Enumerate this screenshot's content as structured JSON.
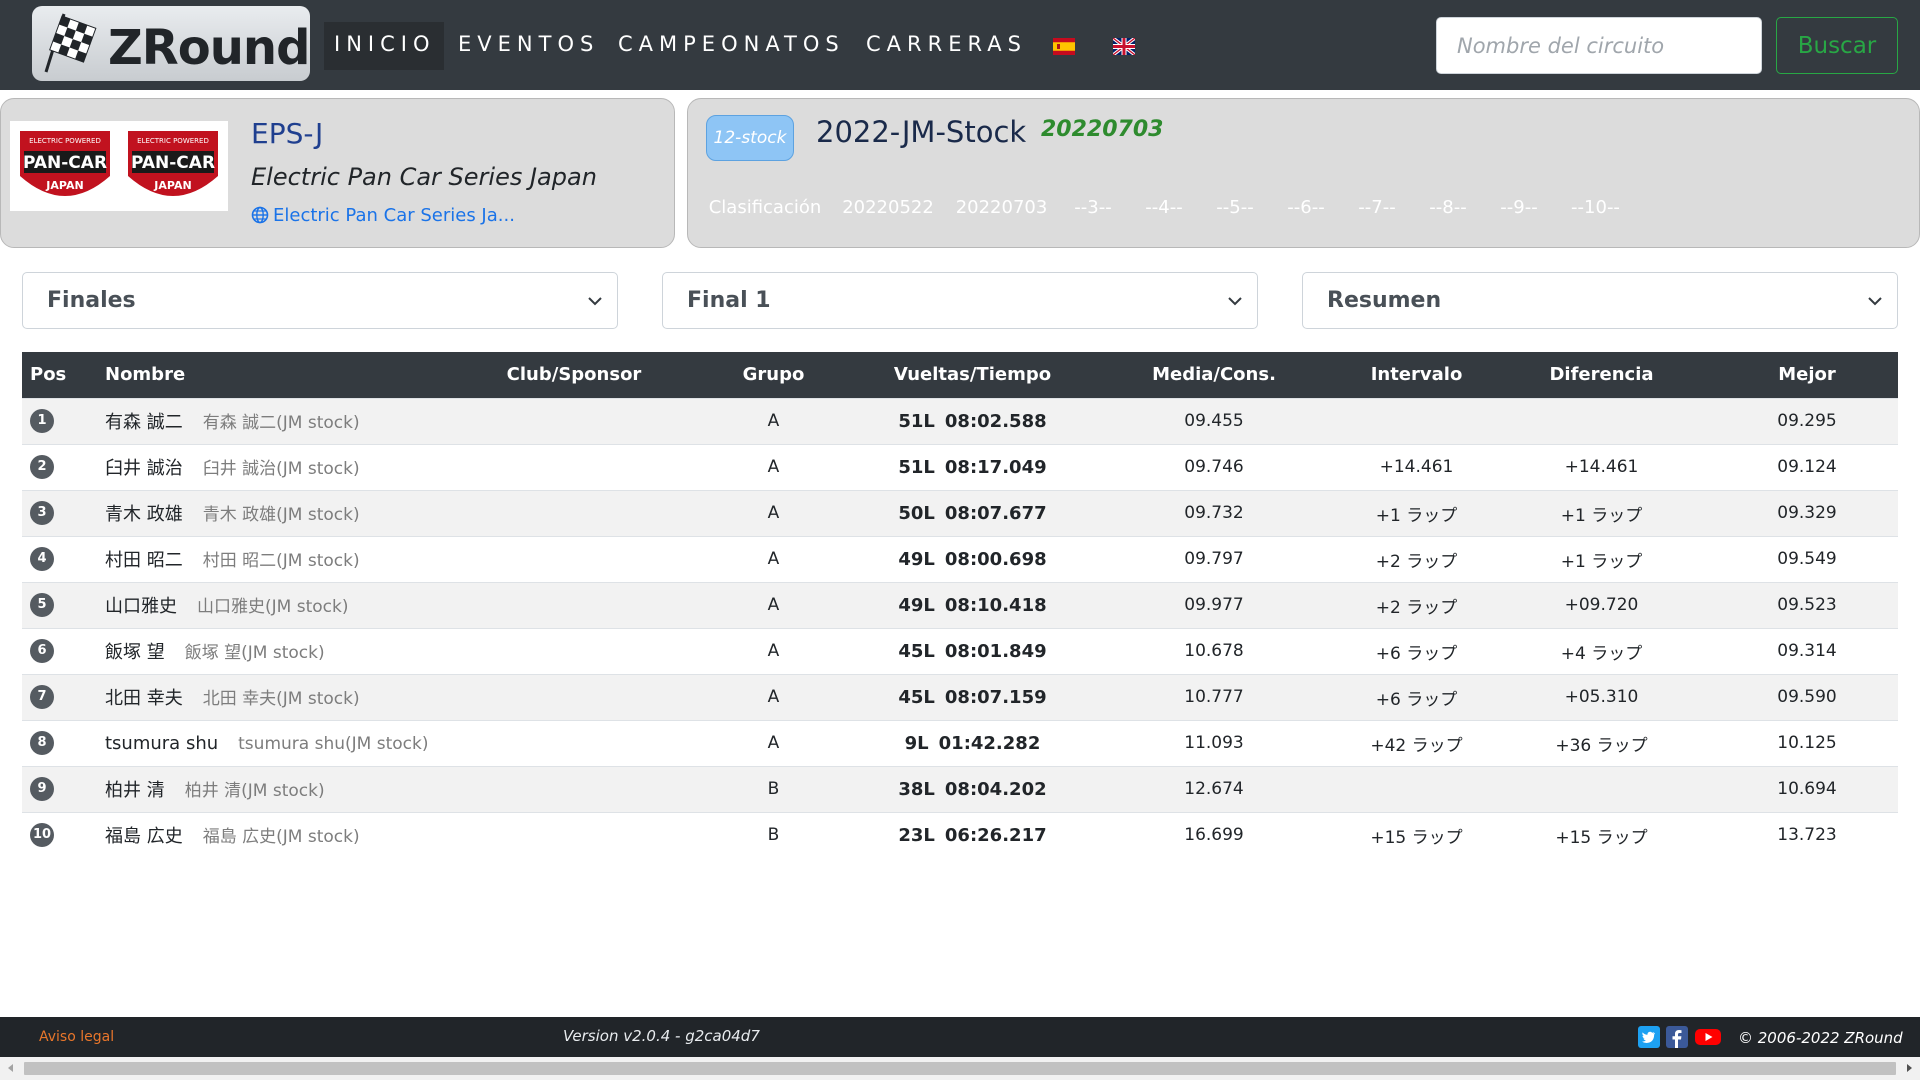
{
  "brand": {
    "name": "ZRound"
  },
  "nav": {
    "items": [
      {
        "label": "INICIO"
      },
      {
        "label": "EVENTOS"
      },
      {
        "label": "CAMPEONATOS"
      },
      {
        "label": "CARRERAS"
      }
    ],
    "flags": [
      "flag-es-icon",
      "flag-gb-icon"
    ]
  },
  "search": {
    "placeholder": "Nombre del circuito",
    "value": "",
    "button": "Buscar"
  },
  "club": {
    "short": "EPS-J",
    "full": "Electric Pan Car Series Japan",
    "link": "Electric Pan Car Series Ja..."
  },
  "championship": {
    "class": "12-stock",
    "title": "2022-JM-Stock",
    "date": "20220703",
    "rounds": [
      {
        "label": "Clasificación",
        "state": "classif"
      },
      {
        "label": "20220522",
        "state": "done"
      },
      {
        "label": "20220703",
        "state": "done"
      },
      {
        "label": "--3--",
        "state": "pending"
      },
      {
        "label": "--4--",
        "state": "pending"
      },
      {
        "label": "--5--",
        "state": "pending"
      },
      {
        "label": "--6--",
        "state": "pending"
      },
      {
        "label": "--7--",
        "state": "pending"
      },
      {
        "label": "--8--",
        "state": "pending"
      },
      {
        "label": "--9--",
        "state": "pending"
      },
      {
        "label": "--10--",
        "state": "pending"
      }
    ]
  },
  "selects": {
    "session_type": "Finales",
    "session": "Final 1",
    "view": "Resumen"
  },
  "table": {
    "headers": [
      "Pos",
      "Nombre",
      "Club/Sponsor",
      "Grupo",
      "Vueltas/Tiempo",
      "Media/Cons.",
      "Intervalo",
      "Diferencia",
      "Mejor"
    ],
    "rows": [
      {
        "pos": "1",
        "name": "有森 誠二",
        "sub": "有森 誠二(JM stock)",
        "club": "",
        "group": "A",
        "laps": "51L",
        "time": "08:02.588",
        "avg": "09.455",
        "interval": "",
        "diff": "",
        "best": "09.295"
      },
      {
        "pos": "2",
        "name": "臼井 誠治",
        "sub": "臼井 誠治(JM stock)",
        "club": "",
        "group": "A",
        "laps": "51L",
        "time": "08:17.049",
        "avg": "09.746",
        "interval": "+14.461",
        "diff": "+14.461",
        "best": "09.124"
      },
      {
        "pos": "3",
        "name": "青木 政雄",
        "sub": "青木 政雄(JM stock)",
        "club": "",
        "group": "A",
        "laps": "50L",
        "time": "08:07.677",
        "avg": "09.732",
        "interval": "+1 ラップ",
        "diff": "+1 ラップ",
        "best": "09.329"
      },
      {
        "pos": "4",
        "name": "村田 昭二",
        "sub": "村田 昭二(JM stock)",
        "club": "",
        "group": "A",
        "laps": "49L",
        "time": "08:00.698",
        "avg": "09.797",
        "interval": "+2 ラップ",
        "diff": "+1 ラップ",
        "best": "09.549"
      },
      {
        "pos": "5",
        "name": "山口雅史",
        "sub": "山口雅史(JM stock)",
        "club": "",
        "group": "A",
        "laps": "49L",
        "time": "08:10.418",
        "avg": "09.977",
        "interval": "+2 ラップ",
        "diff": "+09.720",
        "best": "09.523"
      },
      {
        "pos": "6",
        "name": "飯塚 望",
        "sub": "飯塚 望(JM stock)",
        "club": "",
        "group": "A",
        "laps": "45L",
        "time": "08:01.849",
        "avg": "10.678",
        "interval": "+6 ラップ",
        "diff": "+4 ラップ",
        "best": "09.314"
      },
      {
        "pos": "7",
        "name": "北田 幸夫",
        "sub": "北田 幸夫(JM stock)",
        "club": "",
        "group": "A",
        "laps": "45L",
        "time": "08:07.159",
        "avg": "10.777",
        "interval": "+6 ラップ",
        "diff": "+05.310",
        "best": "09.590"
      },
      {
        "pos": "8",
        "name": "tsumura shu",
        "sub": "tsumura shu(JM stock)",
        "club": "",
        "group": "A",
        "laps": "9L",
        "time": "01:42.282",
        "avg": "11.093",
        "interval": "+42 ラップ",
        "diff": "+36 ラップ",
        "best": "10.125"
      },
      {
        "pos": "9",
        "name": "柏井 清",
        "sub": "柏井 清(JM stock)",
        "club": "",
        "group": "B",
        "laps": "38L",
        "time": "08:04.202",
        "avg": "12.674",
        "interval": "",
        "diff": "",
        "best": "10.694"
      },
      {
        "pos": "10",
        "name": "福島 広史",
        "sub": "福島 広史(JM stock)",
        "club": "",
        "group": "B",
        "laps": "23L",
        "time": "06:26.217",
        "avg": "16.699",
        "interval": "+15 ラップ",
        "diff": "+15 ラップ",
        "best": "13.723"
      }
    ]
  },
  "footer": {
    "legal": "Aviso legal",
    "version": "Version v2.0.4 - g2ca04d7",
    "copyright": "© 2006-2022 ZRound",
    "social": [
      "twitter-icon",
      "facebook-icon",
      "youtube-icon"
    ]
  },
  "colors": {
    "navbar": "#343a40",
    "accent_green": "#28a745",
    "accent_teal": "#17a2b8",
    "link_blue": "#1a73e8",
    "legal_orange": "#e8762b"
  }
}
